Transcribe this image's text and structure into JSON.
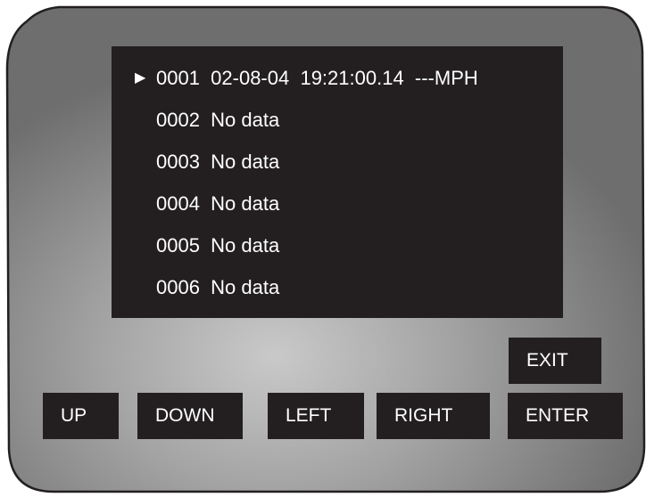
{
  "screen": {
    "cursor_symbol": "▶",
    "rows": [
      {
        "text": "0001  02-08-04  19:21:00.14  ---MPH"
      },
      {
        "text": "0002  No data"
      },
      {
        "text": "0003  No data"
      },
      {
        "text": "0004  No data"
      },
      {
        "text": "0005  No data"
      },
      {
        "text": "0006  No data"
      }
    ]
  },
  "buttons": {
    "exit": "EXIT",
    "up": "UP",
    "down": "DOWN",
    "left": "LEFT",
    "right": "RIGHT",
    "enter": "ENTER"
  },
  "colors": {
    "screen_bg": "#231f20",
    "button_bg": "#231f20",
    "text": "#ffffff",
    "bezel_gray": "#8a8a8a",
    "bezel_highlight": "#c8c8c8",
    "bezel_outline": "#231f20"
  }
}
